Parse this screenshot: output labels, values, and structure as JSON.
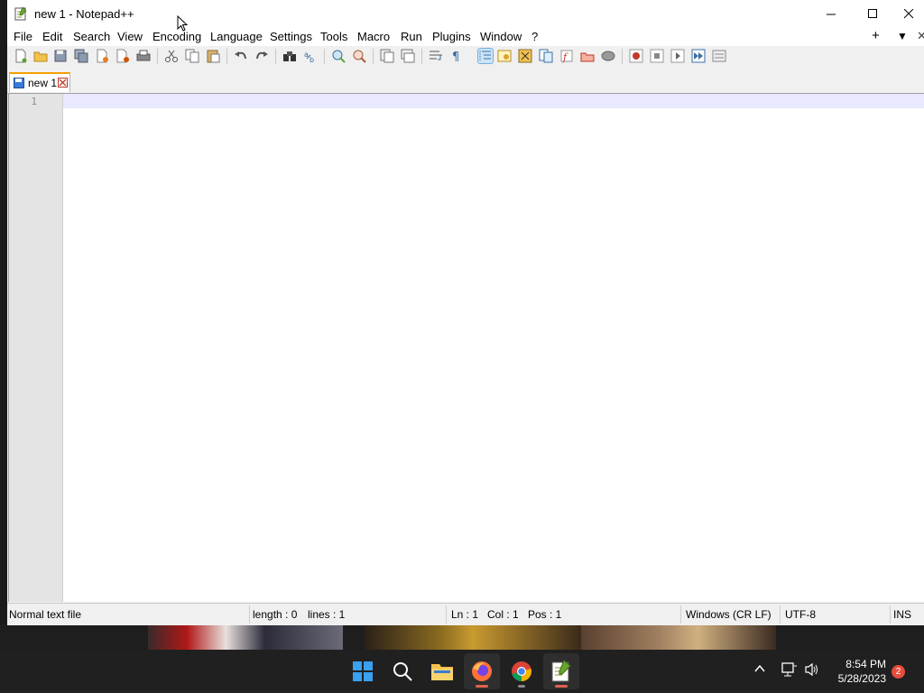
{
  "window": {
    "title": "new 1 - Notepad++"
  },
  "menu": {
    "items": [
      "File",
      "Edit",
      "Search",
      "View",
      "Encoding",
      "Language",
      "Settings",
      "Tools",
      "Macro",
      "Run",
      "Plugins",
      "Window",
      "?"
    ],
    "extra_plus": "+",
    "extra_down": "▼",
    "extra_close": "✕"
  },
  "toolbar": {
    "icons": [
      "new-file-icon",
      "open-file-icon",
      "save-icon",
      "save-all-icon",
      "close-icon",
      "close-all-icon",
      "print-icon",
      "cut-icon",
      "copy-icon",
      "paste-icon",
      "undo-icon",
      "redo-icon",
      "find-icon",
      "replace-icon",
      "zoom-in-icon",
      "zoom-out-icon",
      "sync-vertical-icon",
      "sync-horizontal-icon",
      "word-wrap-icon",
      "show-all-characters-icon",
      "indent-guide-icon",
      "user-defined-language-icon",
      "document-map-icon",
      "function-list-icon",
      "folder-as-workspace-icon",
      "monitoring-icon",
      "start-recording-icon",
      "stop-recording-icon",
      "playback-icon",
      "run-macro-multiple-icon",
      "save-macro-icon"
    ]
  },
  "tab": {
    "label": "new 1"
  },
  "editor": {
    "line_number": "1"
  },
  "status": {
    "filetype": "Normal text file",
    "length": "length : 0",
    "lines": "lines : 1",
    "ln": "Ln : 1",
    "col": "Col : 1",
    "pos": "Pos : 1",
    "eol": "Windows (CR LF)",
    "encoding": "UTF-8",
    "mode": "INS"
  },
  "taskbar": {
    "apps": [
      "windows-start-icon",
      "search-icon",
      "file-explorer-icon",
      "firefox-icon",
      "chrome-icon",
      "notepad-plus-plus-icon"
    ],
    "time": "8:54 PM",
    "date": "5/28/2023",
    "notifications": "2"
  },
  "colors": {
    "accent": "#f4a000",
    "current_line": "#e8e8ff",
    "taskbar": "#202020"
  }
}
